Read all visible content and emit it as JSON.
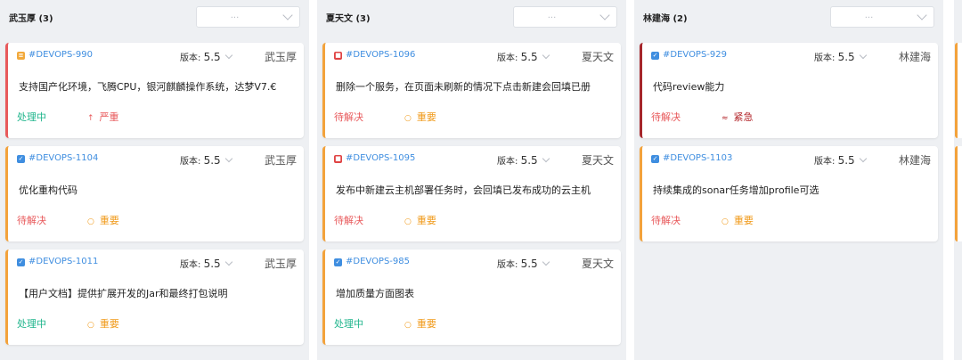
{
  "columns": [
    {
      "title": "武玉厚 (3)",
      "select_placeholder": "...",
      "cards": [
        {
          "type": "story",
          "key": "#DEVOPS-990",
          "version_label": "版本: ",
          "version": "5.5",
          "assignee": "武玉厚",
          "title": "支持国产化环境，飞腾CPU，银河麒麟操作系统，达梦V7.€",
          "status": "处理中",
          "priority_icon": "↑",
          "priority": "严重"
        },
        {
          "type": "task",
          "key": "#DEVOPS-1104",
          "version_label": "版本: ",
          "version": "5.5",
          "assignee": "武玉厚",
          "title": "优化重构代码",
          "status": "待解决",
          "priority_icon": "○",
          "priority": "重要"
        },
        {
          "type": "task",
          "key": "#DEVOPS-1011",
          "version_label": "版本: ",
          "version": "5.5",
          "assignee": "武玉厚",
          "title": "【用户文档】提供扩展开发的Jar和最终打包说明",
          "status": "处理中",
          "priority_icon": "○",
          "priority": "重要"
        }
      ]
    },
    {
      "title": "夏天文 (3)",
      "select_placeholder": "...",
      "cards": [
        {
          "type": "bug",
          "key": "#DEVOPS-1096",
          "version_label": "版本: ",
          "version": "5.5",
          "assignee": "夏天文",
          "title": "删除一个服务，在页面未刷新的情况下点击新建会回填已册",
          "status": "待解决",
          "priority_icon": "○",
          "priority": "重要"
        },
        {
          "type": "bug",
          "key": "#DEVOPS-1095",
          "version_label": "版本: ",
          "version": "5.5",
          "assignee": "夏天文",
          "title": "发布中新建云主机部署任务时，会回填已发布成功的云主机",
          "status": "待解决",
          "priority_icon": "○",
          "priority": "重要"
        },
        {
          "type": "task",
          "key": "#DEVOPS-985",
          "version_label": "版本: ",
          "version": "5.5",
          "assignee": "夏天文",
          "title": "增加质量方面图表",
          "status": "处理中",
          "priority_icon": "○",
          "priority": "重要"
        }
      ]
    },
    {
      "title": "林建海 (2)",
      "select_placeholder": "...",
      "cards": [
        {
          "type": "task",
          "key": "#DEVOPS-929",
          "version_label": "版本: ",
          "version": "5.5",
          "assignee": "林建海",
          "title": "代码review能力",
          "status": "待解决",
          "priority_icon": "≈",
          "priority": "紧急"
        },
        {
          "type": "task",
          "key": "#DEVOPS-1103",
          "version_label": "版本: ",
          "version": "5.5",
          "assignee": "林建海",
          "title": "持续集成的sonar任务增加profile可选",
          "status": "待解决",
          "priority_icon": "○",
          "priority": "重要"
        }
      ]
    }
  ],
  "colors": {
    "accent": "#3f8ee0",
    "status_in_progress": "#1fb58c",
    "status_pending": "#e8595b",
    "priority_important": "#f09a1a",
    "priority_serious": "#e8595b",
    "priority_urgent": "#b3262b"
  }
}
